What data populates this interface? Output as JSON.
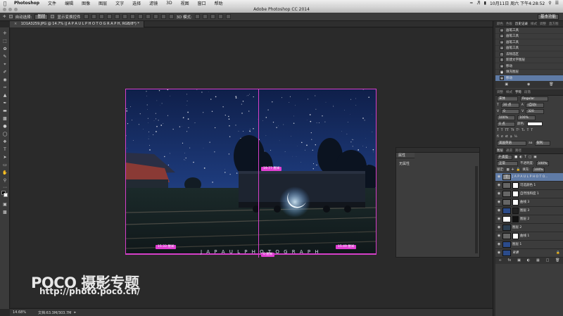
{
  "menubar": {
    "app_name": "Photoshop",
    "items": [
      "文件",
      "编辑",
      "图像",
      "图层",
      "文字",
      "选择",
      "滤镜",
      "3D",
      "视图",
      "窗口",
      "帮助"
    ],
    "clock": "10月11日 周六 下午4:28:52"
  },
  "window": {
    "title": "Adobe Photoshop CC 2014"
  },
  "options": {
    "auto_select_label": "自动选择:",
    "auto_select_value": "图层",
    "show_transform_label": "显示变换控件",
    "mode_3d_label": "3D 模式:",
    "workspace": "基本功能"
  },
  "document": {
    "tab_label": "1D1A3259.JPG @ 14.7% (J A P A U L P H O T O G R A P H, RGB/8*) *"
  },
  "canvas": {
    "overlay_text": "J A P A U L P H O T O G R A P H",
    "measure_top": "19.77 厘米",
    "measure_left": "15.33 厘米",
    "measure_right": "15.49 厘米",
    "measure_bottom": "0 厘米"
  },
  "properties_panel": {
    "tab": "属性",
    "body_text": "无属性"
  },
  "statusbar": {
    "zoom": "14.68%",
    "doc_size": "文档:63.3M/303.7M"
  },
  "history_panel": {
    "tabs": [
      "颜色",
      "色板",
      "历史记录",
      "样式",
      "调整",
      "直方图"
    ],
    "active_tab": "历史记录",
    "items": [
      {
        "label": "画笔工具"
      },
      {
        "label": "画笔工具"
      },
      {
        "label": "画笔工具"
      },
      {
        "label": "画笔工具"
      },
      {
        "label": "去除选区"
      },
      {
        "label": "新建文字图层"
      },
      {
        "label": "移动"
      },
      {
        "label": "填充图层"
      },
      {
        "label": "移动"
      }
    ]
  },
  "character_panel": {
    "tabs": [
      "调整",
      "样式",
      "字符",
      "段落"
    ],
    "active_tab": "字符",
    "font_family": "宋体",
    "font_style": "Regular",
    "font_size": "30 点",
    "leading": "(自动)",
    "kerning": "0",
    "tracking": "320",
    "vertical_scale": "100%",
    "horizontal_scale": "100%",
    "baseline": "0 点",
    "color_label": "颜色:",
    "language": "美国英语",
    "aa_label": "aa",
    "aa_value": "锐利"
  },
  "layers_panel": {
    "tabs": [
      "图层",
      "通道",
      "路径"
    ],
    "active_tab": "图层",
    "kind_filter": "P 类型",
    "blend_mode": "正常",
    "opacity_label": "不透明度:",
    "opacity": "100%",
    "lock_label": "锁定:",
    "fill_label": "填充:",
    "fill": "100%",
    "layers": [
      {
        "name": "J A P A U L P H O T O...",
        "type": "text",
        "selected": true
      },
      {
        "name": "可选颜色 1",
        "type": "adjust"
      },
      {
        "name": "自然饱和度 1",
        "type": "adjust"
      },
      {
        "name": "曲线 3",
        "type": "adjust"
      },
      {
        "name": "图层 3",
        "type": "pixel"
      },
      {
        "name": "图层 2",
        "type": "pixel"
      },
      {
        "name": "图层 2",
        "type": "pixel"
      },
      {
        "name": "曲线 1",
        "type": "adjust"
      },
      {
        "name": "图层 1",
        "type": "pixel"
      },
      {
        "name": "背景",
        "type": "pixel"
      }
    ]
  },
  "watermark": {
    "brand": "POCO 摄影专题",
    "url": "http://photo.poco.cn/"
  }
}
